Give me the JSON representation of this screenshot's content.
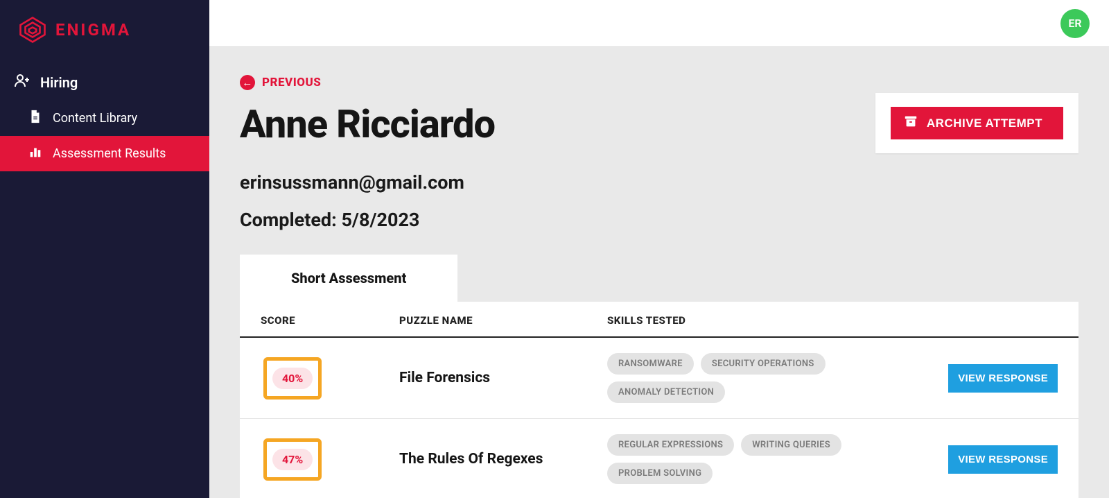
{
  "brand": {
    "name": "ENIGMA"
  },
  "avatar": {
    "initials": "ER"
  },
  "sidebar": {
    "section": "Hiring",
    "items": [
      {
        "label": "Content Library",
        "active": false
      },
      {
        "label": "Assessment Results",
        "active": true
      }
    ]
  },
  "page": {
    "previous_label": "PREVIOUS",
    "candidate_name": "Anne Ricciardo",
    "candidate_email": "erinsussmann@gmail.com",
    "completed_label": "Completed: 5/8/2023",
    "archive_button": "ARCHIVE ATTEMPT"
  },
  "assessment": {
    "tab_label": "Short Assessment",
    "columns": {
      "score": "SCORE",
      "puzzle_name": "PUZZLE NAME",
      "skills_tested": "SKILLS TESTED"
    },
    "view_button_label": "VIEW RESPONSE",
    "rows": [
      {
        "score": "40%",
        "name": "File Forensics",
        "skills": [
          "RANSOMWARE",
          "SECURITY OPERATIONS",
          "ANOMALY DETECTION"
        ]
      },
      {
        "score": "47%",
        "name": "The Rules Of Regexes",
        "skills": [
          "REGULAR EXPRESSIONS",
          "WRITING QUERIES",
          "PROBLEM SOLVING"
        ]
      }
    ]
  },
  "colors": {
    "accent": "#e2153a",
    "highlight": "#f5a623",
    "action": "#1f9fe0",
    "avatar_bg": "#3cc95a"
  }
}
